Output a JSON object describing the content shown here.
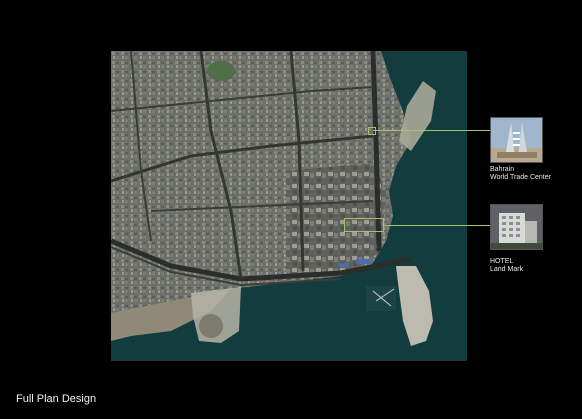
{
  "callouts": [
    {
      "line1": "Bahrain",
      "line2": "World Trade Center"
    },
    {
      "line1": "HOTEL",
      "line2": "Land Mark"
    }
  ],
  "footer_title": "Full Plan Design",
  "colors": {
    "callout_line": "#9fc46a",
    "sea": "#123c3e",
    "city": "#6b6f68"
  }
}
